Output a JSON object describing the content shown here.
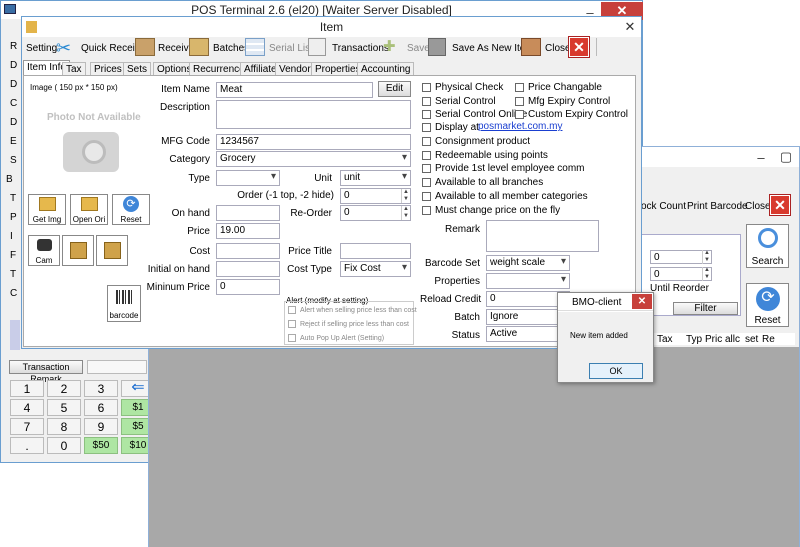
{
  "main_window": {
    "title": "POS Terminal 2.6 (el20) [Waiter Server Disabled]",
    "left_letters": [
      "R",
      "D",
      "D",
      "C",
      "D",
      "E",
      "S",
      "B",
      "T",
      "P",
      "I",
      "F",
      "T",
      "C"
    ],
    "transaction_remark": "Transaction Remark",
    "keypad": [
      "1",
      "2",
      "3",
      "4",
      "5",
      "6",
      "7",
      "8",
      "9",
      ".",
      "0"
    ],
    "money_keys": [
      "$1",
      "$5",
      "$50",
      "$10"
    ]
  },
  "item_window": {
    "title": "Item",
    "toolbar": {
      "setting": "Setting",
      "quick_receive": "Quick Receive",
      "receive": "Receive",
      "batches": "Batches",
      "serial_list": "Serial List",
      "transactions": "Transactions",
      "save": "Save",
      "save_as_new": "Save As New Item",
      "close": "Close"
    },
    "tabs": [
      "Item Info",
      "Tax",
      "Prices",
      "Sets",
      "Options",
      "Recurrence",
      "Affiliate",
      "Vendor",
      "Properties",
      "Accounting"
    ],
    "image_caption": "Image ( 150 px * 150 px)",
    "photo_text": "Photo Not Available",
    "buttons": {
      "get_img": "Get Img",
      "open_ori": "Open Ori",
      "reset": "Reset",
      "cam": "Cam",
      "barcode": "barcode",
      "edit": "Edit"
    },
    "labels": {
      "item_name": "Item Name",
      "description": "Description",
      "mfg_code": "MFG Code",
      "category": "Category",
      "type": "Type",
      "unit": "Unit",
      "order": "Order (-1 top, -2 hide)",
      "on_hand": "On hand",
      "reorder": "Re-Order",
      "price": "Price",
      "cost": "Cost",
      "price_title": "Price Title",
      "initial_on_hand": "Initial on hand",
      "cost_type": "Cost Type",
      "minimum_price": "Mininum Price",
      "remark": "Remark",
      "barcode_set": "Barcode Set",
      "properties": "Properties",
      "reload_credit": "Reload Credit",
      "batch": "Batch",
      "status": "Status"
    },
    "values": {
      "item_name": "Meat",
      "mfg_code": "1234567",
      "category": "Grocery",
      "unit": "unit",
      "order": "0",
      "reorder": "0",
      "price": "19.00",
      "cost_type": "Fix Cost",
      "minimum_price": "0",
      "barcode_set": "weight scale",
      "reload_credit": "0",
      "batch": "Ignore",
      "status": "Active"
    },
    "alert": {
      "title": "Alert (modify at setting)",
      "items": [
        "Alert when selling price less than cost",
        "Reject if selling price less than cost",
        "Auto Pop Up Alert (Setting)"
      ]
    },
    "checks_left": [
      "Physical Check",
      "Serial Control",
      "Serial Control Online",
      "Display at",
      "Consignment product",
      "Redeemable using points",
      "Provide 1st level employee comm",
      "Available to all branches",
      "Available to all member categories",
      "Must change price on the fly"
    ],
    "checks_right": [
      "Price Changable",
      "Mfg Expiry Control",
      "Custom Expiry Control"
    ],
    "display_link": "posmarket.com.my"
  },
  "stock_window": {
    "toolbar": {
      "stock_count": "ock Count",
      "print_barcode": "Print Barcode",
      "close": "Close"
    },
    "fields": [
      "0",
      "0"
    ],
    "until_reorder": "Until Reorder",
    "filter": "Filter",
    "search": "Search",
    "reset": "Reset",
    "columns": [
      "Tax",
      "Typ",
      "Pric",
      "allc",
      "set",
      "Re"
    ]
  },
  "dialog": {
    "title": "BMO-client",
    "message": "New item added",
    "ok": "OK"
  }
}
